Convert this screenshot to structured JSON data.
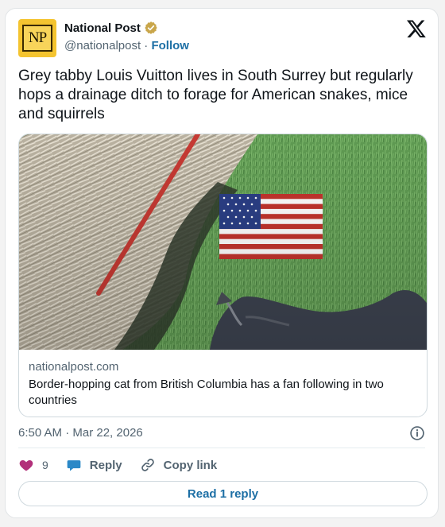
{
  "author": {
    "avatar_text": "NP",
    "name": "National Post",
    "handle": "@nationalpost",
    "separator": "·",
    "follow_label": "Follow"
  },
  "tweet": {
    "text": "Grey tabby Louis Vuitton lives in South Surrey but regularly hops a drainage ditch to forage for American snakes, mice and squirrels",
    "timestamp": "6:50 AM · Mar 22, 2026"
  },
  "link_card": {
    "domain": "nationalpost.com",
    "title": "Border-hopping cat from British Columbia has a fan following in two countries"
  },
  "actions": {
    "likes_count": "9",
    "reply_label": "Reply",
    "copy_link_label": "Copy link"
  },
  "footer": {
    "read_reply_label": "Read 1 reply"
  },
  "colors": {
    "like": "#f91880",
    "reply_bubble": "#1d9bf0",
    "follow": "#1d6fa5",
    "avatar_bg": "#f4c430"
  }
}
